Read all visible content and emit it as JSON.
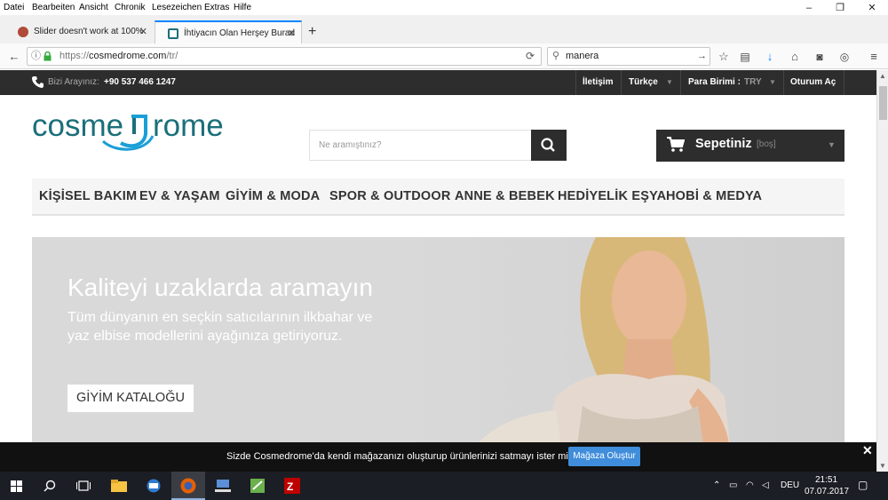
{
  "menubar": {
    "items": [
      "Datei",
      "Bearbeiten",
      "Ansicht",
      "Chronik",
      "Lesezeichen",
      "Extras",
      "Hilfe"
    ]
  },
  "window": {
    "minimize": "–",
    "maximize": "❐",
    "close": "✕"
  },
  "tabs": [
    {
      "title": "Slider doesn't work at 100%"
    },
    {
      "title": "İhtiyacın Olan Herşey Burad"
    }
  ],
  "newtab": "+",
  "urlbar": {
    "prefix": "https://",
    "host": "cosmedrome.com",
    "path": "/tr/"
  },
  "searchbar": {
    "value": "manera"
  },
  "topstrip": {
    "phone_label": "Bizi Arayınız:",
    "phone_number": "+90 537 466 1247",
    "contact": "İletişim",
    "language": "Türkçe",
    "currency_label": "Para Birimi :",
    "currency_value": "TRY",
    "login": "Oturum Aç"
  },
  "logo": {
    "text_left": "cosme",
    "text_right": "rome"
  },
  "search": {
    "placeholder": "Ne aramıştınız?"
  },
  "cart": {
    "label": "Sepetiniz",
    "status": "[boş]"
  },
  "categories": [
    "KİŞİSEL BAKIM",
    "EV & YAŞAM",
    "GİYİM & MODA",
    "SPOR & OUTDOOR",
    "ANNE & BEBEK",
    "HEDİYELİK EŞYA",
    "HOBİ & MEDYA"
  ],
  "hero": {
    "title": "Kaliteyi uzaklarda aramayın",
    "text": "Tüm dünyanın en seçkin satıcılarının ilkbahar ve yaz elbise modellerini ayağınıza getiriyoruz.",
    "button": "GİYİM KATALOĞU"
  },
  "notice": {
    "text": "Sizde Cosmedrome'da kendi mağazanızı oluşturup ürünlerinizi satmayı ister misiniz?",
    "button": "Mağaza Oluştur",
    "close": "✕"
  },
  "taskbar": {
    "language": "DEU",
    "time": "21:51",
    "date": "07.07.2017"
  },
  "colors": {
    "brand_teal": "#1b6f7a",
    "dark": "#2d2d2d",
    "accent_blue": "#3f8ddb"
  }
}
